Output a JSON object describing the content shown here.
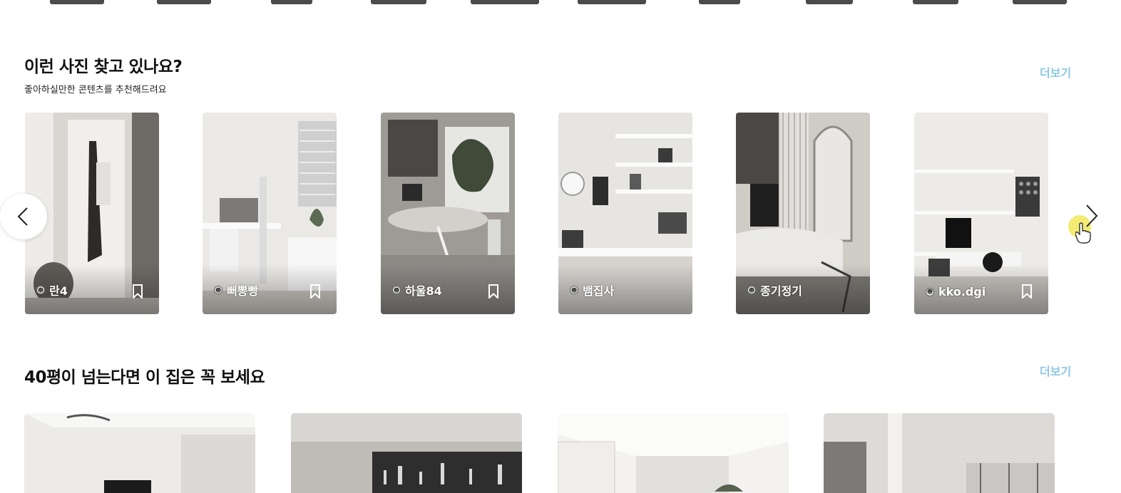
{
  "section1": {
    "title": "이런 사진 찾고 있나요?",
    "subtitle": "좋아하실만한 콘텐츠를 추천해드려요",
    "more": "더보기"
  },
  "cards": [
    {
      "user": "란4"
    },
    {
      "user": "뻐뽕빵"
    },
    {
      "user": "하울84"
    },
    {
      "user": "뱀집사"
    },
    {
      "user": "종기정기"
    },
    {
      "user": "kko.dgi"
    }
  ],
  "section2": {
    "title": "40평이 넘는다면 이 집은 꼭 보세요",
    "more": "더보기"
  },
  "colors": {
    "more_link": "#8ec7e6",
    "cursor_highlight": "#f0e650"
  },
  "icons": {
    "prev": "chevron-left-icon",
    "next": "chevron-right-icon",
    "bookmark": "bookmark-icon",
    "avatar": "avatar-icon"
  }
}
